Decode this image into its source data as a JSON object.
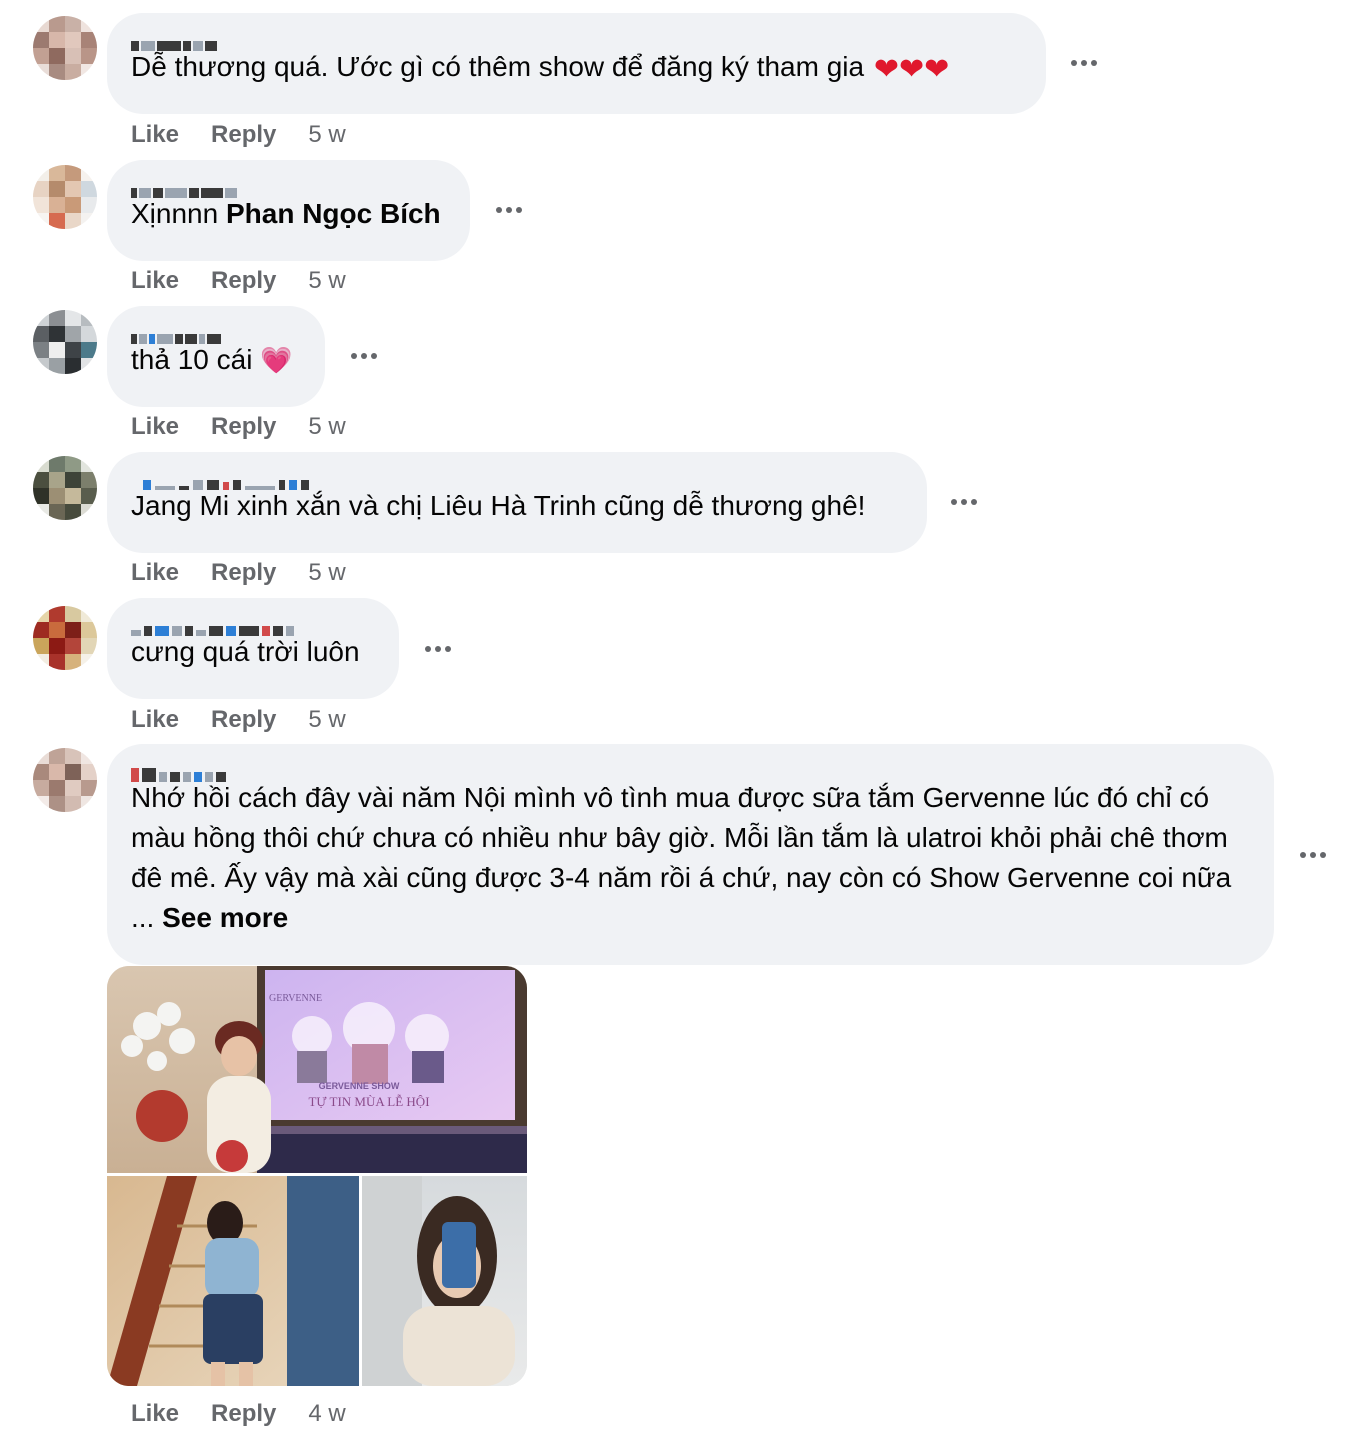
{
  "comments": [
    {
      "text": "Dễ thương quá. Ước gì có thêm show để đăng ký tham gia",
      "hearts": "❤️❤️❤️",
      "like": "Like",
      "reply": "Reply",
      "time": "5 w"
    },
    {
      "text": "Xịnnnn",
      "mention": "Phan Ngọc Bích",
      "like": "Like",
      "reply": "Reply",
      "time": "5 w"
    },
    {
      "text": "thả 10 cái",
      "emoji": "💗",
      "like": "Like",
      "reply": "Reply",
      "time": "5 w"
    },
    {
      "text": "Jang Mi xinh xắn và chị Liêu Hà Trinh cũng dễ thương ghê!",
      "like": "Like",
      "reply": "Reply",
      "time": "5 w"
    },
    {
      "text": "cưng quá trời luôn",
      "like": "Like",
      "reply": "Reply",
      "time": "5 w"
    },
    {
      "text": "Nhớ hồi cách đây vài năm Nội mình vô tình mua được sữa tắm Gervenne lúc đó chỉ có màu hồng thôi chứ chưa có nhiều như bây giờ. Mỗi lần tắm là ulatroi khỏi phải chê thơm đê mê. Ấy vậy mà xài cũng được 3-4 năm rồi á chứ, nay còn có Show Gervenne coi nữa ...",
      "see_more": "See more",
      "like": "Like",
      "reply": "Reply",
      "time": "4 w",
      "photo": {
        "brand": "GERVENNE",
        "show_title": "GERVENNE SHOW",
        "show_subtitle": "TỰ TIN MÙA LỄ HỘI"
      }
    }
  ]
}
